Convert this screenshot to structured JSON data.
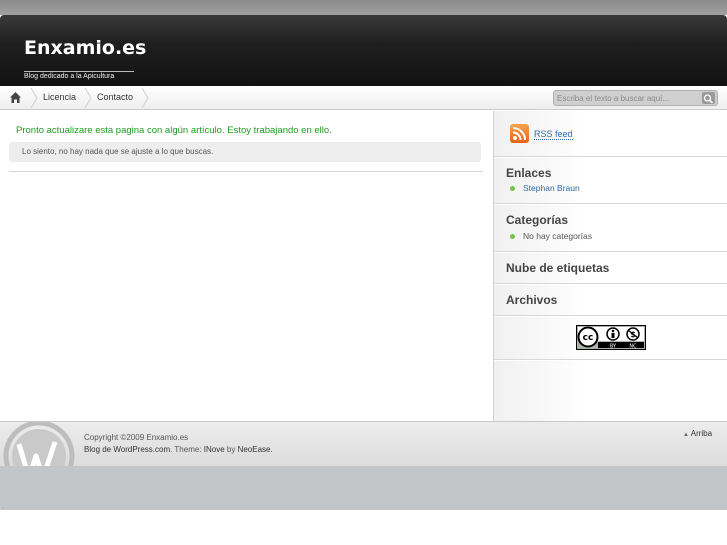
{
  "header": {
    "site_title": "Enxamio.es",
    "site_description": "Blog dedicado a la Apicultura"
  },
  "nav": {
    "home_icon": "home-icon",
    "items": [
      {
        "label": "Licencia"
      },
      {
        "label": "Contacto"
      }
    ]
  },
  "search": {
    "placeholder": "Escriba el texto a buscar aquí...",
    "button_icon": "search-icon"
  },
  "main": {
    "notice": "Pronto actualizare esta pagina con algún artículo. Estoy trabajando en ello.",
    "error": "Lo siento, no hay nada que se ajuste a lo que buscas."
  },
  "sidebar": {
    "rss_label": "RSS feed",
    "links_heading": "Enlaces",
    "links": [
      {
        "label": "Stephan Braun"
      }
    ],
    "categories_heading": "Categorías",
    "categories_empty": "No hay categorías",
    "tagcloud_heading": "Nube de etiquetas",
    "archives_heading": "Archivos",
    "cc_badge": {
      "by": "BY",
      "nc": "NC"
    }
  },
  "footer": {
    "copyright": "Copyright ©2009 Enxamio.es",
    "powered_prefix": "Blog de WordPress.com",
    "theme_prefix": ". Theme: ",
    "theme_name": "INove",
    "by_word": " by ",
    "author": "NeoEase",
    "end": ".",
    "top_link": "Arriba"
  },
  "colors": {
    "header_bg": "#1f1f1f",
    "notice_green": "#1e9b1e",
    "link_blue": "#2f6aa8",
    "bullet_green": "#7ac14e",
    "rss_orange": "#e1621a"
  }
}
